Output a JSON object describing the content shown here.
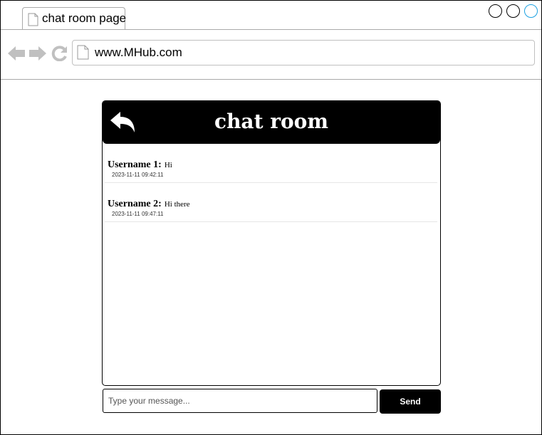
{
  "browser": {
    "tab_title": "chat room page",
    "url": "www.MHub.com",
    "icons": [
      "page-icon",
      "back-arrow-icon",
      "forward-arrow-icon",
      "refresh-icon"
    ],
    "window_controls": [
      "minimize",
      "maximize",
      "close"
    ],
    "colors": {
      "chrome_icon": "#c0c0c0",
      "close_button": "#1ba1e2"
    }
  },
  "chat": {
    "header": {
      "title": "chat room",
      "back_icon": "reply-arrow-icon"
    },
    "messages": [
      {
        "user": "Username 1:",
        "text": "Hi",
        "time": "2023-11-11 09:42:11"
      },
      {
        "user": "Username 2:",
        "text": "Hi there",
        "time": "2023-11-11 09:47:11"
      }
    ],
    "composer": {
      "placeholder": "Type your message...",
      "value": "",
      "send_label": "Send"
    },
    "colors": {
      "header_bg": "#000000",
      "header_text": "#ffffff",
      "send_bg": "#000000"
    }
  }
}
